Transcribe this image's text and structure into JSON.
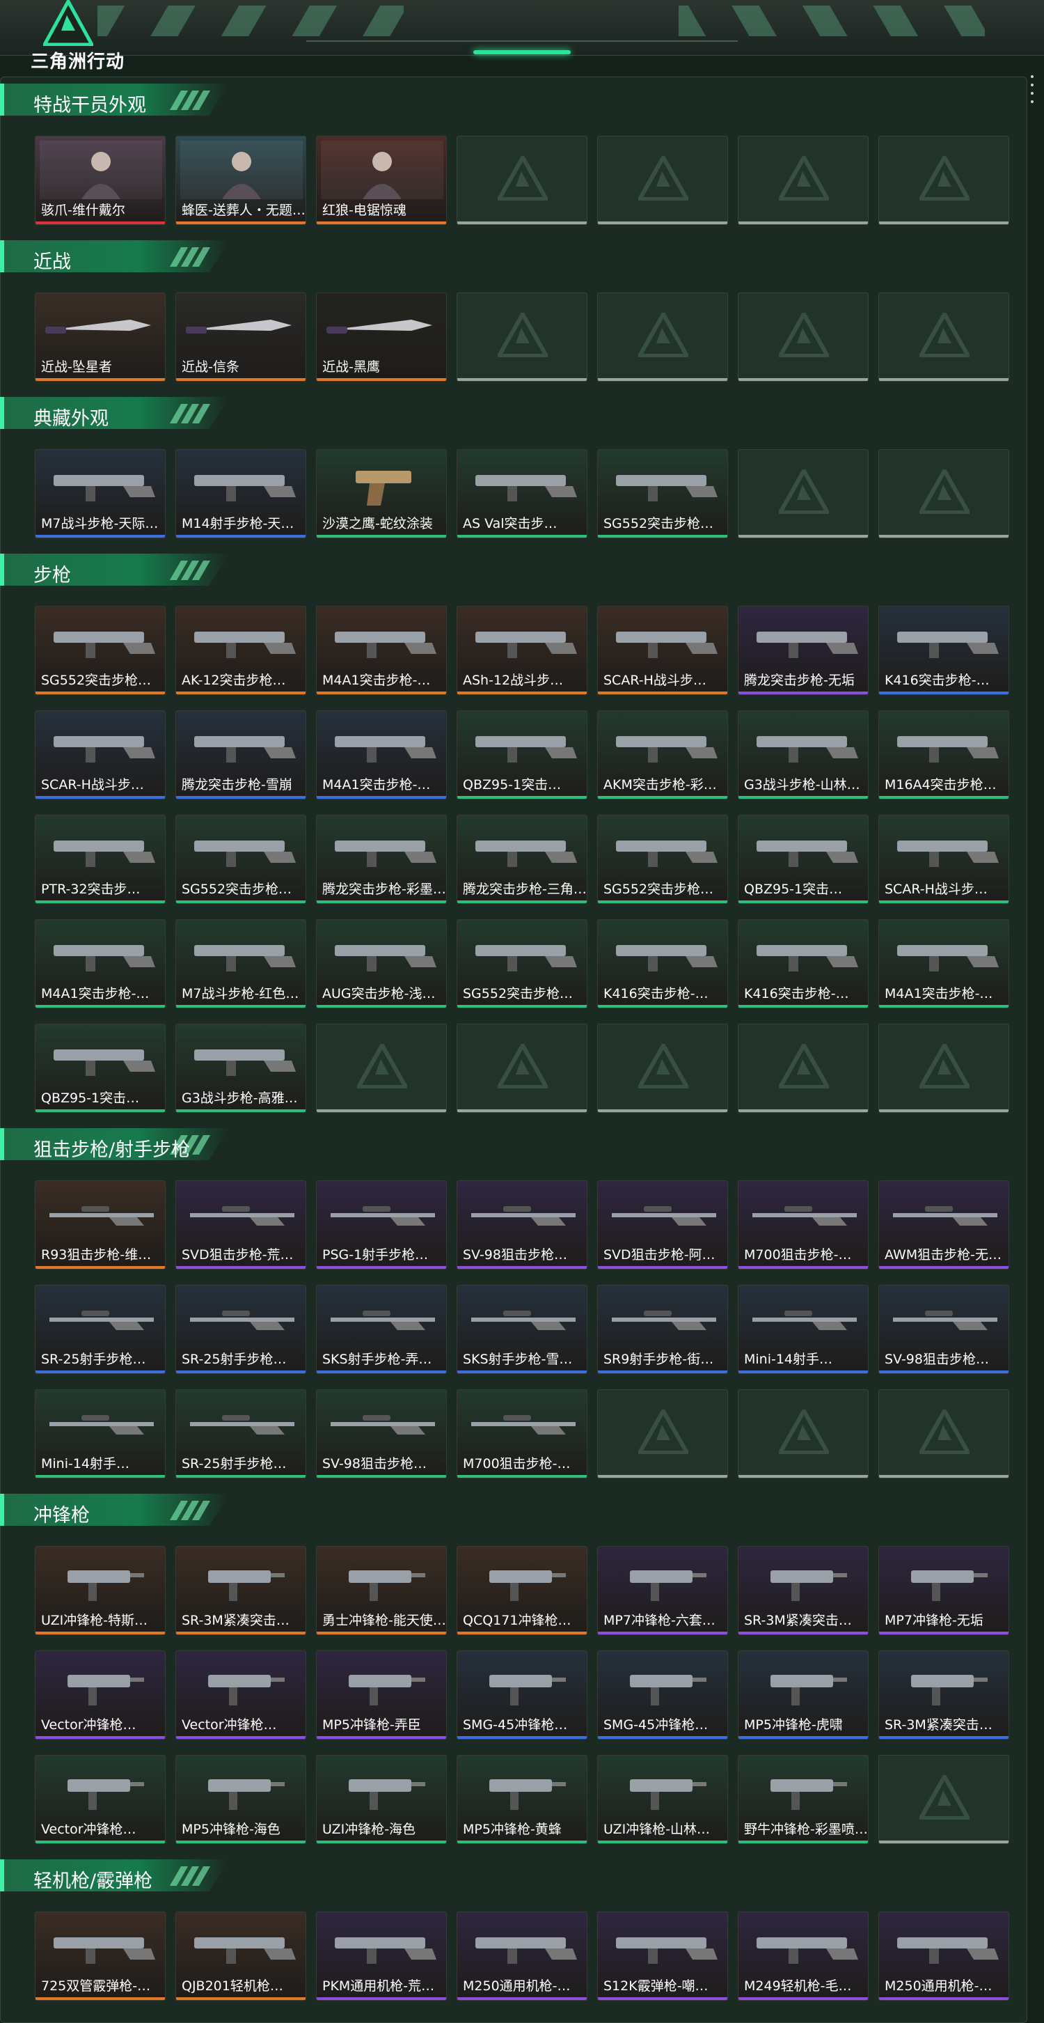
{
  "app": {
    "title": "三角洲行动",
    "accent": "#2de39a",
    "brand_icon": "delta-logo-icon"
  },
  "rarity_colors": {
    "orange": "#e0782a",
    "purple": "#8a4fe0",
    "blue": "#3a6fe0",
    "green": "#2bbf7a",
    "red": "#d8343a",
    "empty": "#9aa59f"
  },
  "sections": [
    {
      "title": "特战干员外观",
      "items": [
        {
          "label": "骇爪-维什戴尔",
          "rarity": "red",
          "bg": "#4a3a48",
          "art": "operator"
        },
        {
          "label": "蜂医-送葬人・无题…",
          "rarity": "orange",
          "bg": "#2f4a52",
          "art": "operator"
        },
        {
          "label": "红狼-电锯惊魂",
          "rarity": "orange",
          "bg": "#4a2a26",
          "art": "operator"
        },
        {
          "label": "",
          "rarity": "empty"
        },
        {
          "label": "",
          "rarity": "empty"
        },
        {
          "label": "",
          "rarity": "empty"
        },
        {
          "label": "",
          "rarity": "empty"
        }
      ]
    },
    {
      "title": "近战",
      "items": [
        {
          "label": "近战-坠星者",
          "rarity": "orange",
          "bg": "#3a2e26",
          "art": "knife"
        },
        {
          "label": "近战-信条",
          "rarity": "orange",
          "bg": "#2a2a28",
          "art": "knife"
        },
        {
          "label": "近战-黑鹰",
          "rarity": "orange",
          "bg": "#24241f",
          "art": "knife"
        },
        {
          "label": "",
          "rarity": "empty"
        },
        {
          "label": "",
          "rarity": "empty"
        },
        {
          "label": "",
          "rarity": "empty"
        },
        {
          "label": "",
          "rarity": "empty"
        }
      ]
    },
    {
      "title": "典藏外观",
      "items": [
        {
          "label": "M7战斗步枪-天际…",
          "rarity": "blue",
          "bg": "#25303c",
          "art": "rifle"
        },
        {
          "label": "M14射手步枪-天…",
          "rarity": "blue",
          "bg": "#25303c",
          "art": "rifle"
        },
        {
          "label": "沙漠之鹰-蛇纹涂装",
          "rarity": "green",
          "bg": "#233a2e",
          "art": "pistol"
        },
        {
          "label": "AS Val突击步…",
          "rarity": "green",
          "bg": "#233a2e",
          "art": "rifle"
        },
        {
          "label": "SG552突击步枪…",
          "rarity": "green",
          "bg": "#233a2e",
          "art": "rifle"
        },
        {
          "label": "",
          "rarity": "empty"
        },
        {
          "label": "",
          "rarity": "empty"
        }
      ]
    },
    {
      "title": "步枪",
      "items": [
        {
          "label": "SG552突击步枪…",
          "rarity": "orange",
          "bg": "#3a2c24",
          "art": "rifle"
        },
        {
          "label": "AK-12突击步枪…",
          "rarity": "orange",
          "bg": "#3a2c24",
          "art": "rifle"
        },
        {
          "label": "M4A1突击步枪-…",
          "rarity": "orange",
          "bg": "#3a2c24",
          "art": "rifle"
        },
        {
          "label": "ASh-12战斗步…",
          "rarity": "orange",
          "bg": "#3a2c24",
          "art": "rifle"
        },
        {
          "label": "SCAR-H战斗步…",
          "rarity": "orange",
          "bg": "#3a2c24",
          "art": "rifle"
        },
        {
          "label": "腾龙突击步枪-无垢",
          "rarity": "purple",
          "bg": "#2e2640",
          "art": "rifle"
        },
        {
          "label": "K416突击步枪-…",
          "rarity": "blue",
          "bg": "#25303c",
          "art": "rifle"
        },
        {
          "label": "SCAR-H战斗步…",
          "rarity": "blue",
          "bg": "#25303c",
          "art": "rifle"
        },
        {
          "label": "腾龙突击步枪-雪崩",
          "rarity": "blue",
          "bg": "#25303c",
          "art": "rifle"
        },
        {
          "label": "M4A1突击步枪-…",
          "rarity": "blue",
          "bg": "#25303c",
          "art": "rifle"
        },
        {
          "label": "QBZ95-1突击…",
          "rarity": "green",
          "bg": "#233a2e",
          "art": "rifle"
        },
        {
          "label": "AKM突击步枪-彩…",
          "rarity": "green",
          "bg": "#233a2e",
          "art": "rifle"
        },
        {
          "label": "G3战斗步枪-山林…",
          "rarity": "green",
          "bg": "#233a2e",
          "art": "rifle"
        },
        {
          "label": "M16A4突击步枪…",
          "rarity": "green",
          "bg": "#233a2e",
          "art": "rifle"
        },
        {
          "label": "PTR-32突击步…",
          "rarity": "green",
          "bg": "#233a2e",
          "art": "rifle"
        },
        {
          "label": "SG552突击步枪…",
          "rarity": "green",
          "bg": "#233a2e",
          "art": "rifle"
        },
        {
          "label": "腾龙突击步枪-彩墨…",
          "rarity": "green",
          "bg": "#233a2e",
          "art": "rifle"
        },
        {
          "label": "腾龙突击步枪-三角…",
          "rarity": "green",
          "bg": "#233a2e",
          "art": "rifle"
        },
        {
          "label": "SG552突击步枪…",
          "rarity": "green",
          "bg": "#233a2e",
          "art": "rifle"
        },
        {
          "label": "QBZ95-1突击…",
          "rarity": "green",
          "bg": "#233a2e",
          "art": "rifle"
        },
        {
          "label": "SCAR-H战斗步…",
          "rarity": "green",
          "bg": "#233a2e",
          "art": "rifle"
        },
        {
          "label": "M4A1突击步枪-…",
          "rarity": "green",
          "bg": "#233a2e",
          "art": "rifle"
        },
        {
          "label": "M7战斗步枪-红色…",
          "rarity": "green",
          "bg": "#233a2e",
          "art": "rifle"
        },
        {
          "label": "AUG突击步枪-浅…",
          "rarity": "green",
          "bg": "#233a2e",
          "art": "rifle"
        },
        {
          "label": "SG552突击步枪…",
          "rarity": "green",
          "bg": "#233a2e",
          "art": "rifle"
        },
        {
          "label": "K416突击步枪-…",
          "rarity": "green",
          "bg": "#233a2e",
          "art": "rifle"
        },
        {
          "label": "K416突击步枪-…",
          "rarity": "green",
          "bg": "#233a2e",
          "art": "rifle"
        },
        {
          "label": "M4A1突击步枪-…",
          "rarity": "green",
          "bg": "#233a2e",
          "art": "rifle"
        },
        {
          "label": "QBZ95-1突击…",
          "rarity": "green",
          "bg": "#233a2e",
          "art": "rifle"
        },
        {
          "label": "G3战斗步枪-高雅…",
          "rarity": "green",
          "bg": "#233a2e",
          "art": "rifle"
        },
        {
          "label": "",
          "rarity": "empty"
        },
        {
          "label": "",
          "rarity": "empty"
        },
        {
          "label": "",
          "rarity": "empty"
        },
        {
          "label": "",
          "rarity": "empty"
        },
        {
          "label": "",
          "rarity": "empty"
        }
      ]
    },
    {
      "title": "狙击步枪/射手步枪",
      "items": [
        {
          "label": "R93狙击步枪-维…",
          "rarity": "orange",
          "bg": "#3a2c24",
          "art": "sniper"
        },
        {
          "label": "SVD狙击步枪-荒…",
          "rarity": "purple",
          "bg": "#2e2640",
          "art": "sniper"
        },
        {
          "label": "PSG-1射手步枪…",
          "rarity": "purple",
          "bg": "#2e2640",
          "art": "sniper"
        },
        {
          "label": "SV-98狙击步枪…",
          "rarity": "purple",
          "bg": "#2e2640",
          "art": "sniper"
        },
        {
          "label": "SVD狙击步枪-阿…",
          "rarity": "purple",
          "bg": "#2e2640",
          "art": "sniper"
        },
        {
          "label": "M700狙击步枪-…",
          "rarity": "purple",
          "bg": "#2e2640",
          "art": "sniper"
        },
        {
          "label": "AWM狙击步枪-无…",
          "rarity": "purple",
          "bg": "#2e2640",
          "art": "sniper"
        },
        {
          "label": "SR-25射手步枪…",
          "rarity": "blue",
          "bg": "#25303c",
          "art": "sniper"
        },
        {
          "label": "SR-25射手步枪…",
          "rarity": "blue",
          "bg": "#25303c",
          "art": "sniper"
        },
        {
          "label": "SKS射手步枪-弄…",
          "rarity": "blue",
          "bg": "#25303c",
          "art": "sniper"
        },
        {
          "label": "SKS射手步枪-雪…",
          "rarity": "blue",
          "bg": "#25303c",
          "art": "sniper"
        },
        {
          "label": "SR9射手步枪-街…",
          "rarity": "blue",
          "bg": "#25303c",
          "art": "sniper"
        },
        {
          "label": "Mini-14射手…",
          "rarity": "blue",
          "bg": "#25303c",
          "art": "sniper"
        },
        {
          "label": "SV-98狙击步枪…",
          "rarity": "blue",
          "bg": "#25303c",
          "art": "sniper"
        },
        {
          "label": "Mini-14射手…",
          "rarity": "green",
          "bg": "#233a2e",
          "art": "sniper"
        },
        {
          "label": "SR-25射手步枪…",
          "rarity": "green",
          "bg": "#233a2e",
          "art": "sniper"
        },
        {
          "label": "SV-98狙击步枪…",
          "rarity": "green",
          "bg": "#233a2e",
          "art": "sniper"
        },
        {
          "label": "M700狙击步枪-…",
          "rarity": "green",
          "bg": "#233a2e",
          "art": "sniper"
        },
        {
          "label": "",
          "rarity": "empty"
        },
        {
          "label": "",
          "rarity": "empty"
        },
        {
          "label": "",
          "rarity": "empty"
        }
      ]
    },
    {
      "title": "冲锋枪",
      "items": [
        {
          "label": "UZI冲锋枪-特斯…",
          "rarity": "orange",
          "bg": "#3a2c24",
          "art": "smg"
        },
        {
          "label": "SR-3M紧凑突击…",
          "rarity": "orange",
          "bg": "#3a2c24",
          "art": "smg"
        },
        {
          "label": "勇士冲锋枪-能天使…",
          "rarity": "orange",
          "bg": "#3a2c24",
          "art": "smg"
        },
        {
          "label": "QCQ171冲锋枪…",
          "rarity": "orange",
          "bg": "#3a2c24",
          "art": "smg"
        },
        {
          "label": "MP7冲锋枪-六套…",
          "rarity": "purple",
          "bg": "#2e2640",
          "art": "smg"
        },
        {
          "label": "SR-3M紧凑突击…",
          "rarity": "purple",
          "bg": "#2e2640",
          "art": "smg"
        },
        {
          "label": "MP7冲锋枪-无垢",
          "rarity": "purple",
          "bg": "#2e2640",
          "art": "smg"
        },
        {
          "label": "Vector冲锋枪…",
          "rarity": "purple",
          "bg": "#2e2640",
          "art": "smg"
        },
        {
          "label": "Vector冲锋枪…",
          "rarity": "purple",
          "bg": "#2e2640",
          "art": "smg"
        },
        {
          "label": "MP5冲锋枪-弄臣",
          "rarity": "purple",
          "bg": "#2e2640",
          "art": "smg"
        },
        {
          "label": "SMG-45冲锋枪…",
          "rarity": "blue",
          "bg": "#25303c",
          "art": "smg"
        },
        {
          "label": "SMG-45冲锋枪…",
          "rarity": "blue",
          "bg": "#25303c",
          "art": "smg"
        },
        {
          "label": "MP5冲锋枪-虎啸",
          "rarity": "blue",
          "bg": "#25303c",
          "art": "smg"
        },
        {
          "label": "SR-3M紧凑突击…",
          "rarity": "blue",
          "bg": "#25303c",
          "art": "smg"
        },
        {
          "label": "Vector冲锋枪…",
          "rarity": "green",
          "bg": "#233a2e",
          "art": "smg"
        },
        {
          "label": "MP5冲锋枪-海色",
          "rarity": "green",
          "bg": "#233a2e",
          "art": "smg"
        },
        {
          "label": "UZI冲锋枪-海色",
          "rarity": "green",
          "bg": "#233a2e",
          "art": "smg"
        },
        {
          "label": "MP5冲锋枪-黄蜂",
          "rarity": "green",
          "bg": "#233a2e",
          "art": "smg"
        },
        {
          "label": "UZI冲锋枪-山林…",
          "rarity": "green",
          "bg": "#233a2e",
          "art": "smg"
        },
        {
          "label": "野牛冲锋枪-彩墨喷…",
          "rarity": "green",
          "bg": "#233a2e",
          "art": "smg"
        },
        {
          "label": "",
          "rarity": "empty"
        }
      ]
    },
    {
      "title": "轻机枪/霰弹枪",
      "items": [
        {
          "label": "725双管霰弹枪-…",
          "rarity": "orange",
          "bg": "#3a2c24",
          "art": "rifle"
        },
        {
          "label": "QJB201轻机枪…",
          "rarity": "orange",
          "bg": "#3a2c24",
          "art": "rifle"
        },
        {
          "label": "PKM通用机枪-荒…",
          "rarity": "purple",
          "bg": "#2e2640",
          "art": "rifle"
        },
        {
          "label": "M250通用机枪-…",
          "rarity": "purple",
          "bg": "#2e2640",
          "art": "rifle"
        },
        {
          "label": "S12K霰弹枪-嘲…",
          "rarity": "purple",
          "bg": "#2e2640",
          "art": "rifle"
        },
        {
          "label": "M249轻机枪-毛…",
          "rarity": "purple",
          "bg": "#2e2640",
          "art": "rifle"
        },
        {
          "label": "M250通用机枪-…",
          "rarity": "purple",
          "bg": "#2e2640",
          "art": "rifle"
        }
      ]
    }
  ]
}
